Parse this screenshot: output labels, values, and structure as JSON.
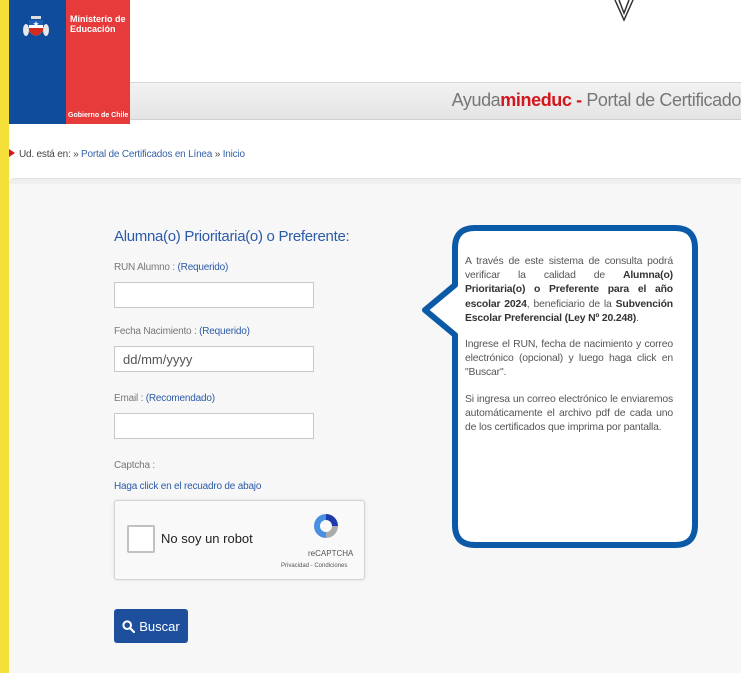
{
  "header": {
    "ministry_line1": "Ministerio de",
    "ministry_line2": "Educación",
    "gobierno": "Gobierno de Chile",
    "portal_brand_prefix": "Ayuda",
    "portal_brand_main": "mineduc",
    "portal_dash": " - ",
    "portal_title": "Portal de Certificado"
  },
  "breadcrumb": {
    "lead": "Ud. está en: » ",
    "link1": "Portal de Certificados en Línea",
    "sep": " » ",
    "link2": "Inicio"
  },
  "form": {
    "title": "Alumna(o) Prioritaria(o) o Preferente:",
    "run_label": "RUN Alumno : ",
    "run_req": "(Requerido)",
    "run_value": "",
    "fecha_label": "Fecha Nacimiento : ",
    "fecha_req": "(Requerido)",
    "fecha_placeholder": "dd/mm/yyyy",
    "email_label": "Email : ",
    "email_req": "(Recomendado)",
    "email_value": "",
    "captcha_label": "Captcha :",
    "captcha_hint": "Haga click en el recuadro de abajo",
    "search_button": "Buscar"
  },
  "recaptcha": {
    "label": "No soy un robot",
    "brand": "reCAPTCHA",
    "terms": "Privacidad - Condiciones"
  },
  "info": {
    "p1_a": "A través de este sistema de consulta podrá verificar la calidad de ",
    "p1_b": "Alumna(o) Prioritaria(o) o Preferente para el año escolar 2024",
    "p1_c": ", beneficiario de la ",
    "p1_d": "Subvención Escolar Preferencial (Ley Nº 20.248)",
    "p1_e": ".",
    "p2": "Ingrese el RUN, fecha de nacimiento y correo electrónico (opcional) y luego haga click en \"Buscar\".",
    "p3": "Si ingresa un correo electrónico le enviaremos automáticamente el archivo pdf de cada uno de los certificados que imprima por pantalla."
  },
  "colors": {
    "outer_frame": "#f5e03a",
    "gov_blue": "#0f4c9c",
    "gov_red": "#e73b3b",
    "link_blue": "#2b5aa8",
    "bubble_border": "#0a5aa8"
  },
  "icons": {
    "coat_of_arms": "chile-coat-of-arms-icon",
    "breadcrumb": "red-arrow-icon",
    "search": "search-icon",
    "recaptcha": "recaptcha-logo-icon"
  }
}
